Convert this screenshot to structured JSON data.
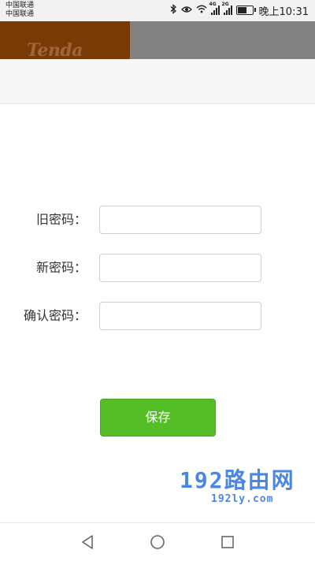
{
  "status_bar": {
    "carrier_1": "中国联通",
    "carrier_2": "中国联通",
    "network_1": "4G",
    "network_2": "2G",
    "time": "晚上10:31",
    "battery_level_percent": 70
  },
  "header": {
    "brand": "Tenda",
    "brand_color": "#7a3a06"
  },
  "form": {
    "old_password": {
      "label": "旧密码：",
      "value": ""
    },
    "new_password": {
      "label": "新密码：",
      "value": ""
    },
    "confirm_password": {
      "label": "确认密码：",
      "value": ""
    }
  },
  "save_button": {
    "label": "保存",
    "color": "#55bd26"
  },
  "watermark": {
    "title": "192路由网",
    "url": "192ly.com"
  },
  "nav": {
    "icons": [
      "back-icon",
      "home-icon",
      "recent-apps-icon"
    ]
  }
}
